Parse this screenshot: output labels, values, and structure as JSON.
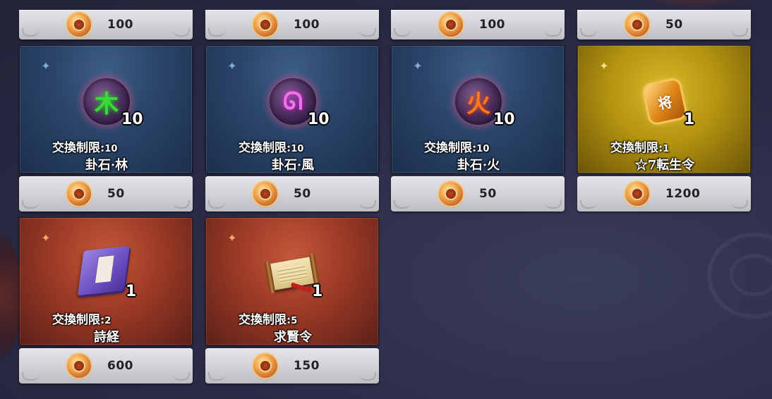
{
  "top_row_prices": [
    "100",
    "100",
    "100",
    "50"
  ],
  "items": [
    {
      "name": "卦石·林",
      "quantity": "10",
      "limit_label": "交換制限:",
      "limit_value": "10",
      "price": "50",
      "icon": "green-trigram-orb-icon",
      "bg": "blue",
      "glyph": "木"
    },
    {
      "name": "卦石·風",
      "quantity": "10",
      "limit_label": "交換制限:",
      "limit_value": "10",
      "price": "50",
      "icon": "pink-wind-orb-icon",
      "bg": "blue",
      "glyph": "ᘏ"
    },
    {
      "name": "卦石·火",
      "quantity": "10",
      "limit_label": "交換制限:",
      "limit_value": "10",
      "price": "50",
      "icon": "fire-orb-icon",
      "bg": "blue",
      "glyph": "火"
    },
    {
      "name": "☆7転生令",
      "quantity": "1",
      "limit_label": "交換制限:",
      "limit_value": "1",
      "price": "1200",
      "icon": "gold-general-badge-icon",
      "bg": "gold",
      "glyph": "将"
    },
    {
      "name": "詩経",
      "quantity": "1",
      "limit_label": "交換制限:",
      "limit_value": "2",
      "price": "600",
      "icon": "purple-book-icon",
      "bg": "red"
    },
    {
      "name": "求賢令",
      "quantity": "1",
      "limit_label": "交換制限:",
      "limit_value": "5",
      "price": "150",
      "icon": "scroll-icon",
      "bg": "red"
    }
  ],
  "currency_icon": "copper-coin-icon"
}
